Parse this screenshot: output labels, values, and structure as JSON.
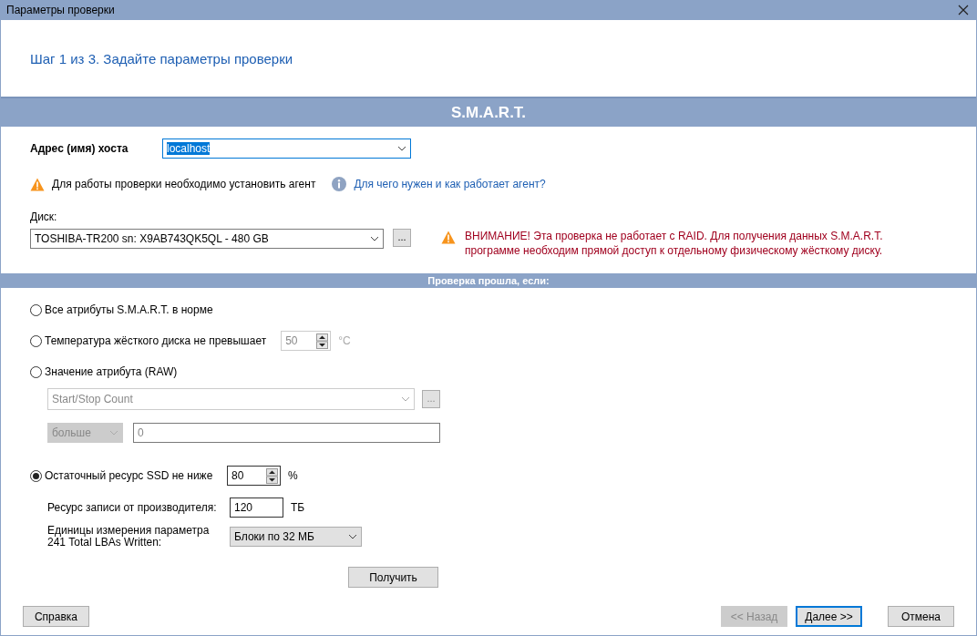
{
  "window": {
    "title": "Параметры проверки"
  },
  "step_title": "Шаг 1 из 3. Задайте параметры проверки",
  "section_title": "S.M.A.R.T.",
  "host": {
    "label": "Адрес (имя) хоста",
    "value": "localhost"
  },
  "agent_warning": {
    "text": "Для работы проверки необходимо установить агент",
    "help_link": "Для чего нужен и как работает агент?"
  },
  "disk": {
    "label": "Диск:",
    "value": "TOSHIBA-TR200 sn: X9AB743QK5QL - 480 GB",
    "browse": "..."
  },
  "raid_warning": "ВНИМАНИЕ! Эта проверка не работает с RAID. Для получения данных S.M.A.R.T. программе необходим прямой доступ к отдельному физическому жёсткому диску.",
  "criteria_header": "Проверка прошла, если:",
  "criteria": [
    {
      "kind": "plain",
      "label": "Все атрибуты S.M.A.R.T. в норме",
      "selected": false
    },
    {
      "kind": "temperature",
      "label": "Температура жёсткого диска не превышает",
      "selected": false,
      "value": "50",
      "unit": "°C"
    },
    {
      "kind": "attribute",
      "label": "Значение атрибута (RAW)",
      "selected": false,
      "attribute": "Start/Stop Count",
      "browse": "...",
      "comparison": "больше",
      "threshold": "0"
    },
    {
      "kind": "ssd",
      "label": "Остаточный ресурс SSD не ниже",
      "selected": true,
      "value": "80",
      "unit": "%",
      "write_resource": {
        "label": "Ресурс записи от производителя:",
        "value": "120",
        "unit": "ТБ"
      },
      "units": {
        "label_lines": [
          "Единицы измерения параметра",
          "241 Total  LBAs  Written:"
        ],
        "value": "Блоки по 32 МБ"
      },
      "fetch_button": "Получить"
    }
  ],
  "footer": {
    "help": "Справка",
    "nav": [
      {
        "label": "<< Назад",
        "disabled": true,
        "default": false
      },
      {
        "label": "Далее >>",
        "disabled": false,
        "default": true
      },
      {
        "label": "Отмена",
        "disabled": false,
        "default": false
      }
    ]
  }
}
